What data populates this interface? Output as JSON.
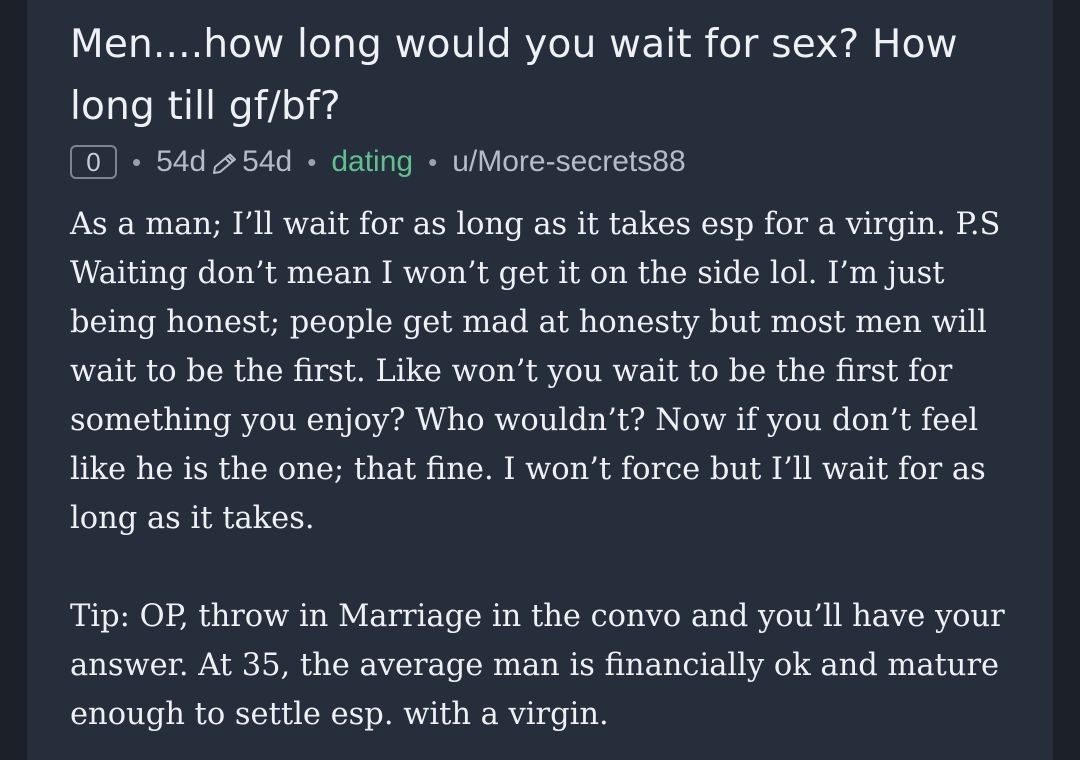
{
  "post": {
    "title": "Men....how long would you wait for sex? How long till gf/bf?",
    "score": "0",
    "posted_age": "54d",
    "edited_age": "54d",
    "community": "dating",
    "author": "u/More-secrets88",
    "body_paragraphs": [
      "As a man; I’ll wait for as long as it takes esp for a virgin. P.S Waiting don’t mean I won’t get it on the side lol. I’m just being honest; people get mad at honesty but most men will wait to be the first. Like won’t you wait to be the first for something you enjoy? Who wouldn’t? Now if you don’t feel like he is the one; that fine. I won’t force but I’ll wait for as long as it takes.",
      "Tip: OP, throw in Marriage in the convo and you’ll have your answer. At 35, the average man is financially ok and mature enough to settle esp. with a virgin."
    ]
  },
  "icons": {
    "edited": "pencil-icon"
  },
  "colors": {
    "background": "#1b2029",
    "card": "#262e3c",
    "text": "#eef0f3",
    "meta_text": "#b6bcc6",
    "community": "#5fbf8f"
  }
}
